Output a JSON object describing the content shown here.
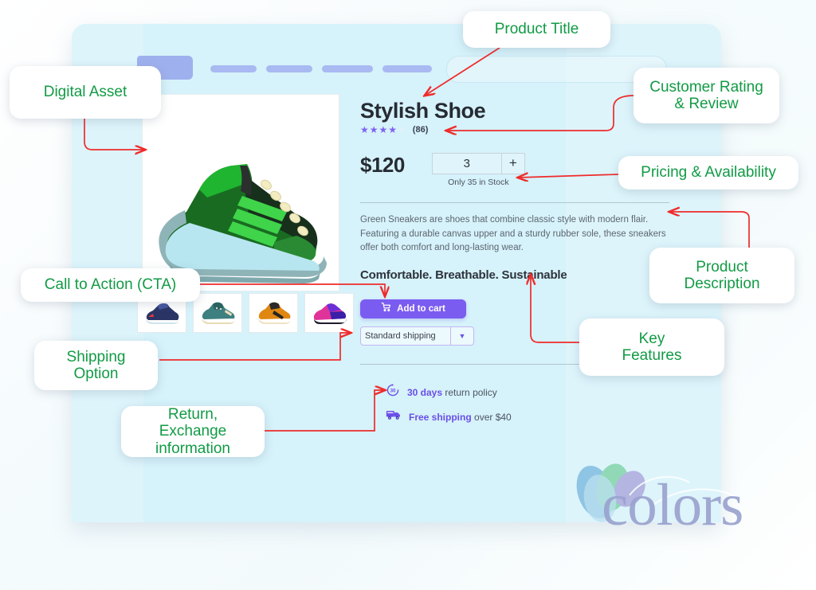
{
  "store": {
    "header": {
      "logo": "brand-logo-block",
      "nav_items": [
        "",
        "",
        "",
        ""
      ],
      "search_placeholder": ""
    },
    "product": {
      "title": "Stylish Shoe",
      "rating_stars_filled": 4,
      "rating_stars_total": 5,
      "review_count": "(86)",
      "price": "$120",
      "quantity": "3",
      "quantity_plus": "+",
      "stock": "Only 35 in Stock",
      "description": "Green Sneakers are  shoes that combine classic style with modern flair. Featuring a durable canvas upper and a sturdy rubber sole, these sneakers offer both comfort and long-lasting wear.",
      "features": "Comfortable. Breathable. Sustainable",
      "add_to_cart": "Add to cart",
      "shipping_selected": "Standard shipping",
      "shipping_options": [
        "Standard shipping"
      ],
      "perks": [
        {
          "highlight": "30 days",
          "rest": " return policy",
          "icon": "return-30-days-icon"
        },
        {
          "highlight": "Free shipping",
          "rest": " over $40",
          "icon": "delivery-truck-icon"
        }
      ],
      "main_image_alt": "green-sneaker",
      "thumbnails": [
        "navy-sneaker",
        "teal-sneaker",
        "orange-sneaker",
        "pink-sneaker"
      ]
    }
  },
  "watermark": {
    "text": "colors"
  },
  "annotations": {
    "product_title": "Product Title",
    "digital_asset": "Digital Asset",
    "customer_rating": "Customer Rating\n& Review",
    "customer_rating_l1": "Customer Rating",
    "customer_rating_l2": "& Review",
    "pricing": "Pricing & Availability",
    "product_description_l1": "Product",
    "product_description_l2": "Description",
    "cta": "Call to Action (CTA)",
    "key_features_l1": "Key",
    "key_features_l2": "Features",
    "shipping_option_l1": "Shipping",
    "shipping_option_l2": "Option",
    "return_exchange_l1": "Return, Exchange",
    "return_exchange_l2": "information"
  },
  "colors": {
    "annotation_text": "#119b45",
    "arrow": "#ef2b2b",
    "accent_purple": "#7b5cf0",
    "panel_bg": "#ddf4fb",
    "star": "#7e63f4"
  }
}
